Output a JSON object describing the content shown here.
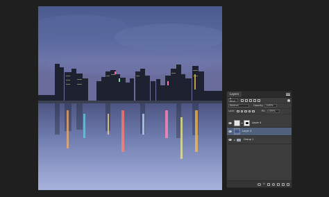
{
  "layers_panel": {
    "tab_label": "Layers",
    "filter_kind": "ρ Kind",
    "blend_mode": "Normal",
    "opacity_label": "Opacity:",
    "opacity_value": "100%",
    "lock_label": "Lock:",
    "fill_label": "Fill:",
    "fill_value": "100%",
    "layers": [
      {
        "name": "Layer 4",
        "selected": false,
        "type": "white-with-mask"
      },
      {
        "name": "Layer 3",
        "selected": true,
        "type": "photo"
      },
      {
        "name": "Group 1",
        "selected": false,
        "type": "group"
      }
    ],
    "footer_icons": [
      "link-icon",
      "fx-icon",
      "mask-icon",
      "adjustment-icon",
      "folder-icon",
      "new-layer-icon",
      "trash-icon"
    ]
  },
  "colors": {
    "app_background": "#1f1f1f",
    "panel_background": "#3c3c3c",
    "selected_layer": "#50617c"
  }
}
